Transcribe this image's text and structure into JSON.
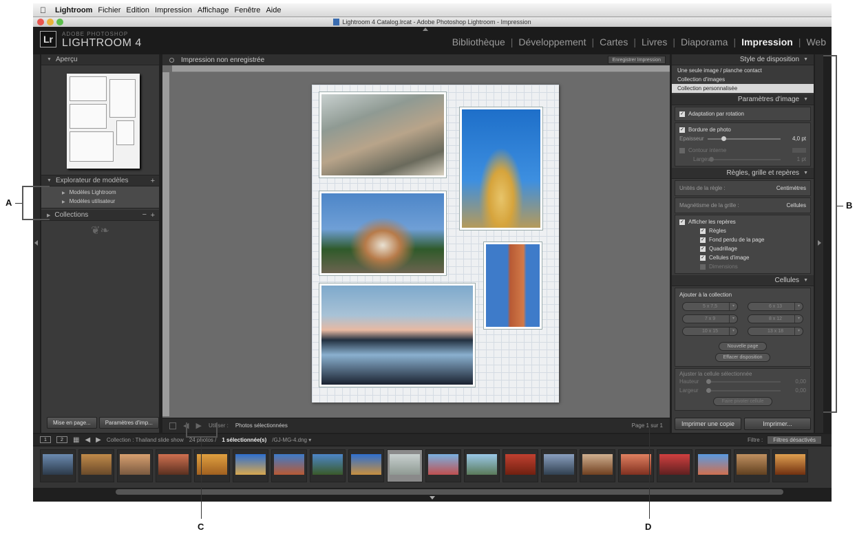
{
  "menubar": {
    "app": "Lightroom",
    "items": [
      "Fichier",
      "Edition",
      "Impression",
      "Affichage",
      "Fenêtre",
      "Aide"
    ]
  },
  "window": {
    "title": "Lightroom 4 Catalog.lrcat - Adobe Photoshop Lightroom - Impression"
  },
  "brand": {
    "badge": "Lr",
    "line1": "ADOBE PHOTOSHOP",
    "line2": "LIGHTROOM 4"
  },
  "modules": [
    "Bibliothèque",
    "Développement",
    "Cartes",
    "Livres",
    "Diaporama",
    "Impression",
    "Web"
  ],
  "active_module": "Impression",
  "left_panel": {
    "preview_title": "Aperçu",
    "template_browser_title": "Explorateur de modèles",
    "templates": [
      "Modèles Lightroom",
      "Modèles utilisateur"
    ],
    "collections_title": "Collections",
    "btn_page_setup": "Mise en page...",
    "btn_print_settings": "Paramètres d'imp..."
  },
  "center": {
    "title": "Impression non enregistrée",
    "save_btn": "Enregistrer Impression",
    "toolbar_use_label": "Utiliser :",
    "toolbar_use_value": "Photos sélectionnées",
    "page_count": "Page 1 sur 1"
  },
  "right_panel": {
    "layout_style_title": "Style de disposition",
    "layout_styles": [
      "Une seule image / planche contact",
      "Collection d'images",
      "Collection personnalisée"
    ],
    "selected_layout": 2,
    "image_settings_title": "Paramètres d'image",
    "rotate_to_fit": "Adaptation par rotation",
    "photo_border": "Bordure de photo",
    "thickness_label": "Epaisseur",
    "thickness_value": "4,0 pt",
    "inner_stroke": "Contour interne",
    "width_label": "Largeur",
    "width_value": "1 pt",
    "rulers_title": "Règles, grille et repères",
    "ruler_units_label": "Unités de la règle :",
    "ruler_units_value": "Centimètres",
    "grid_snap_label": "Magnétisme de la grille :",
    "grid_snap_value": "Cellules",
    "show_guides": "Afficher les repères",
    "guides": [
      "Règles",
      "Fond perdu de la page",
      "Quadrillage",
      "Cellules d'image",
      "Dimensions"
    ],
    "guides_checked": [
      true,
      true,
      true,
      true,
      false
    ],
    "cells_title": "Cellules",
    "add_to_package": "Ajouter à la collection",
    "cell_sizes": [
      "5 x 7,5",
      "6 x 13",
      "7 x 9",
      "8 x 12",
      "10 x 15",
      "13 x 18"
    ],
    "new_page": "Nouvelle page",
    "clear_layout": "Effacer disposition",
    "adjust_selected": "Ajuster la cellule sélectionnée",
    "height_label": "Hauteur",
    "height_value": "0,00",
    "width2_label": "Largeur",
    "width2_value": "0,00",
    "rotate_cell": "Faire pivoter cellule",
    "btn_print_one": "Imprimer une copie",
    "btn_print": "Imprimer..."
  },
  "filmstrip": {
    "page1": "1",
    "page2": "2",
    "collection_info": "Collection : Thailand slide show",
    "count_info": "24 photos /",
    "selected_info": "1 sélectionnée(s)",
    "file_info": "/GJ-MG-4.dng ▾",
    "filter_label": "Filtre :",
    "filter_value": "Filtres désactivés"
  },
  "callouts": [
    "A",
    "B",
    "C",
    "D"
  ],
  "icons": {
    "apple": "apple-icon",
    "triangle": "disclosure-triangle-icon"
  },
  "colors": {
    "app_bg": "#1f1f1f",
    "panel_bg": "#3a3a3a",
    "workspace_bg": "#6b6b6b",
    "active_module": "#f0f0f0"
  }
}
